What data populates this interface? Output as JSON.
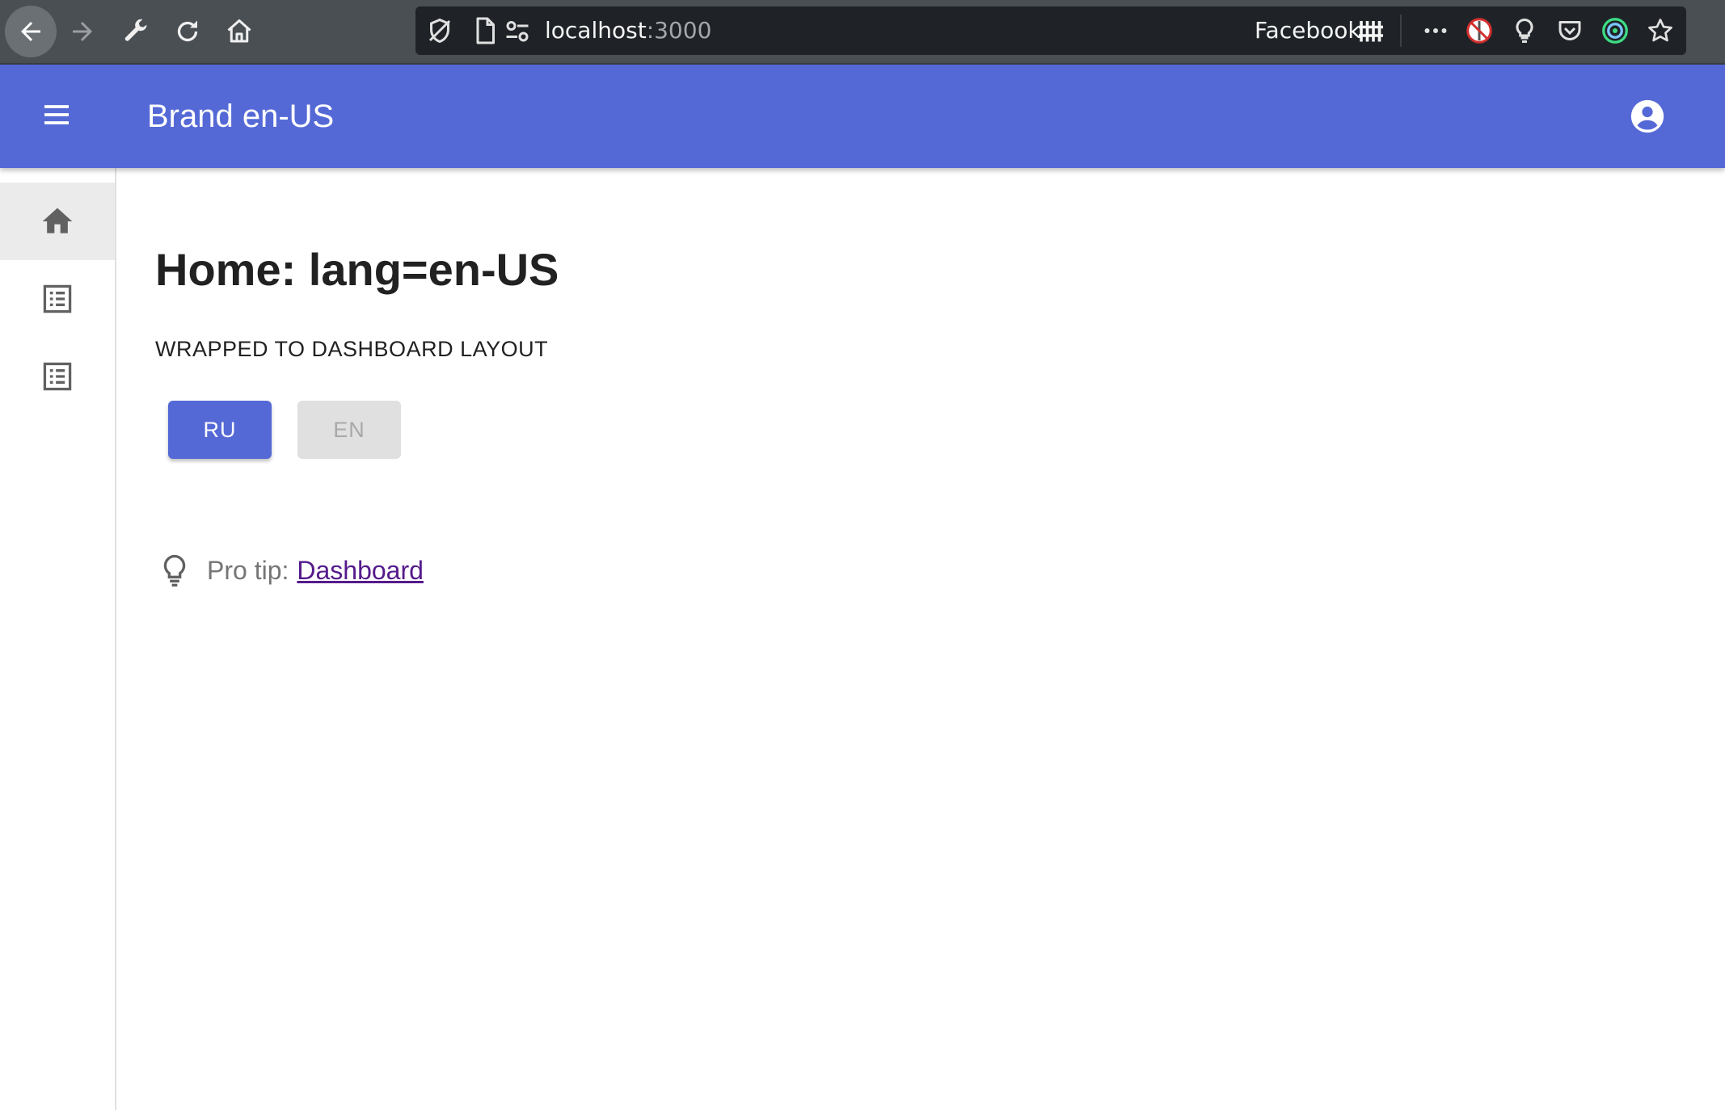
{
  "browser": {
    "url_host": "localhost",
    "url_port": ":3000",
    "bookmark_label": "Facebook"
  },
  "appbar": {
    "brand": "Brand en-US"
  },
  "sidenav": {
    "items": [
      {
        "name": "home",
        "icon": "home-icon",
        "selected": true
      },
      {
        "name": "list-1",
        "icon": "list-icon",
        "selected": false
      },
      {
        "name": "list-2",
        "icon": "list-icon",
        "selected": false
      }
    ]
  },
  "main": {
    "title": "Home: lang=en-US",
    "subtitle": "WRAPPED TO DASHBOARD LAYOUT",
    "buttons": {
      "ru": "RU",
      "en": "EN"
    },
    "protip": {
      "label": "Pro tip:",
      "link": "Dashboard"
    }
  },
  "colors": {
    "primary": "#5569d6",
    "browser_chrome": "#4a4f54",
    "text_dark": "#212121",
    "link_visited": "#551a8b"
  }
}
